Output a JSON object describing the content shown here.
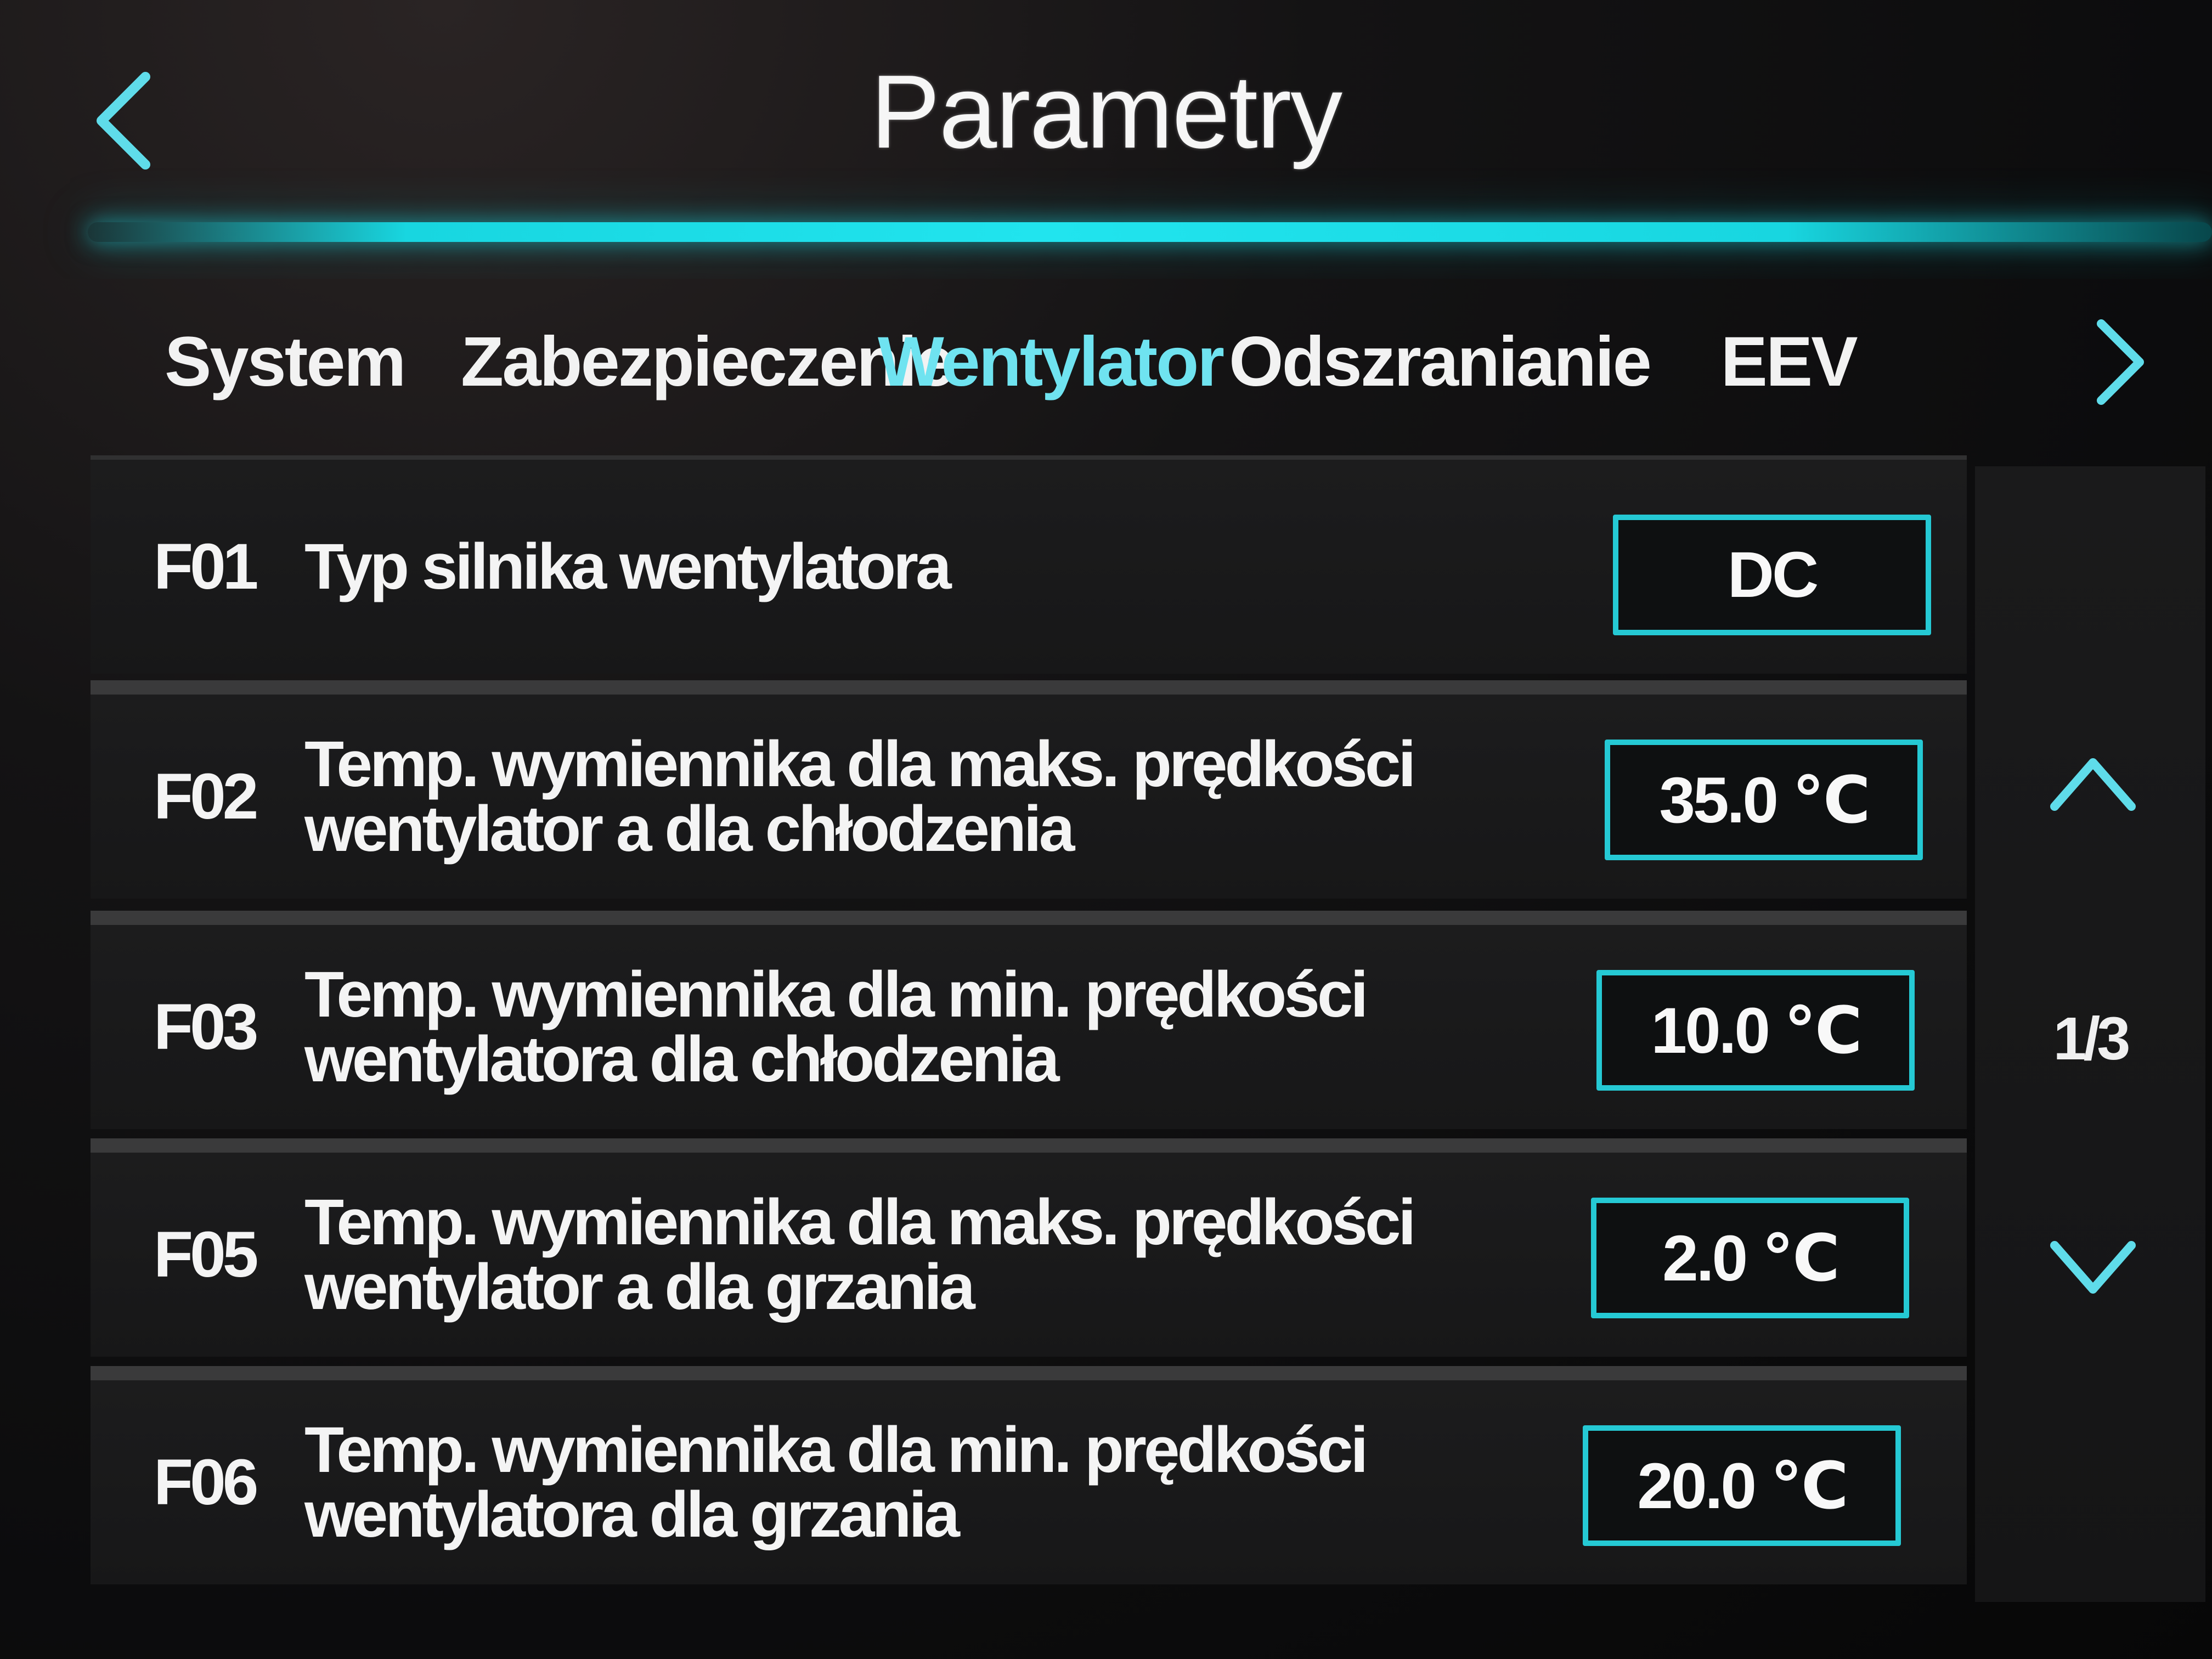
{
  "header": {
    "title": "Parametry",
    "back_icon": "chevron-left-icon"
  },
  "tabs": [
    {
      "label": "System",
      "active": false
    },
    {
      "label": "Zabezpieczenie",
      "active": false
    },
    {
      "label": "Wentylator",
      "active": true
    },
    {
      "label": "Odszranianie",
      "active": false
    },
    {
      "label": "EEV",
      "active": false
    }
  ],
  "tabs_next_icon": "chevron-right-icon",
  "parameters": [
    {
      "code": "F01",
      "label": "Typ silnika wentylatora",
      "value": "DC"
    },
    {
      "code": "F02",
      "label": "Temp. wymiennika dla maks. prędkości wentylator a dla chłodzenia",
      "value": "35.0 ℃"
    },
    {
      "code": "F03",
      "label": "Temp. wymiennika dla min. prędkości wentylatora dla chłodzenia",
      "value": "10.0 ℃"
    },
    {
      "code": "F05",
      "label": "Temp. wymiennika dla maks. prędkości wentylator a dla grzania",
      "value": "2.0 ℃"
    },
    {
      "code": "F06",
      "label": "Temp. wymiennika dla min. prędkości wentylatora dla grzania",
      "value": "20.0 ℃"
    }
  ],
  "pager": {
    "indicator": "1/3",
    "up_icon": "chevron-up-icon",
    "down_icon": "chevron-down-icon"
  },
  "colors": {
    "accent": "#25c9d4",
    "active_tab": "#6fe3f0",
    "background": "#0b0b0c",
    "row_background": "#1a1a1b",
    "text": "#ffffff"
  }
}
